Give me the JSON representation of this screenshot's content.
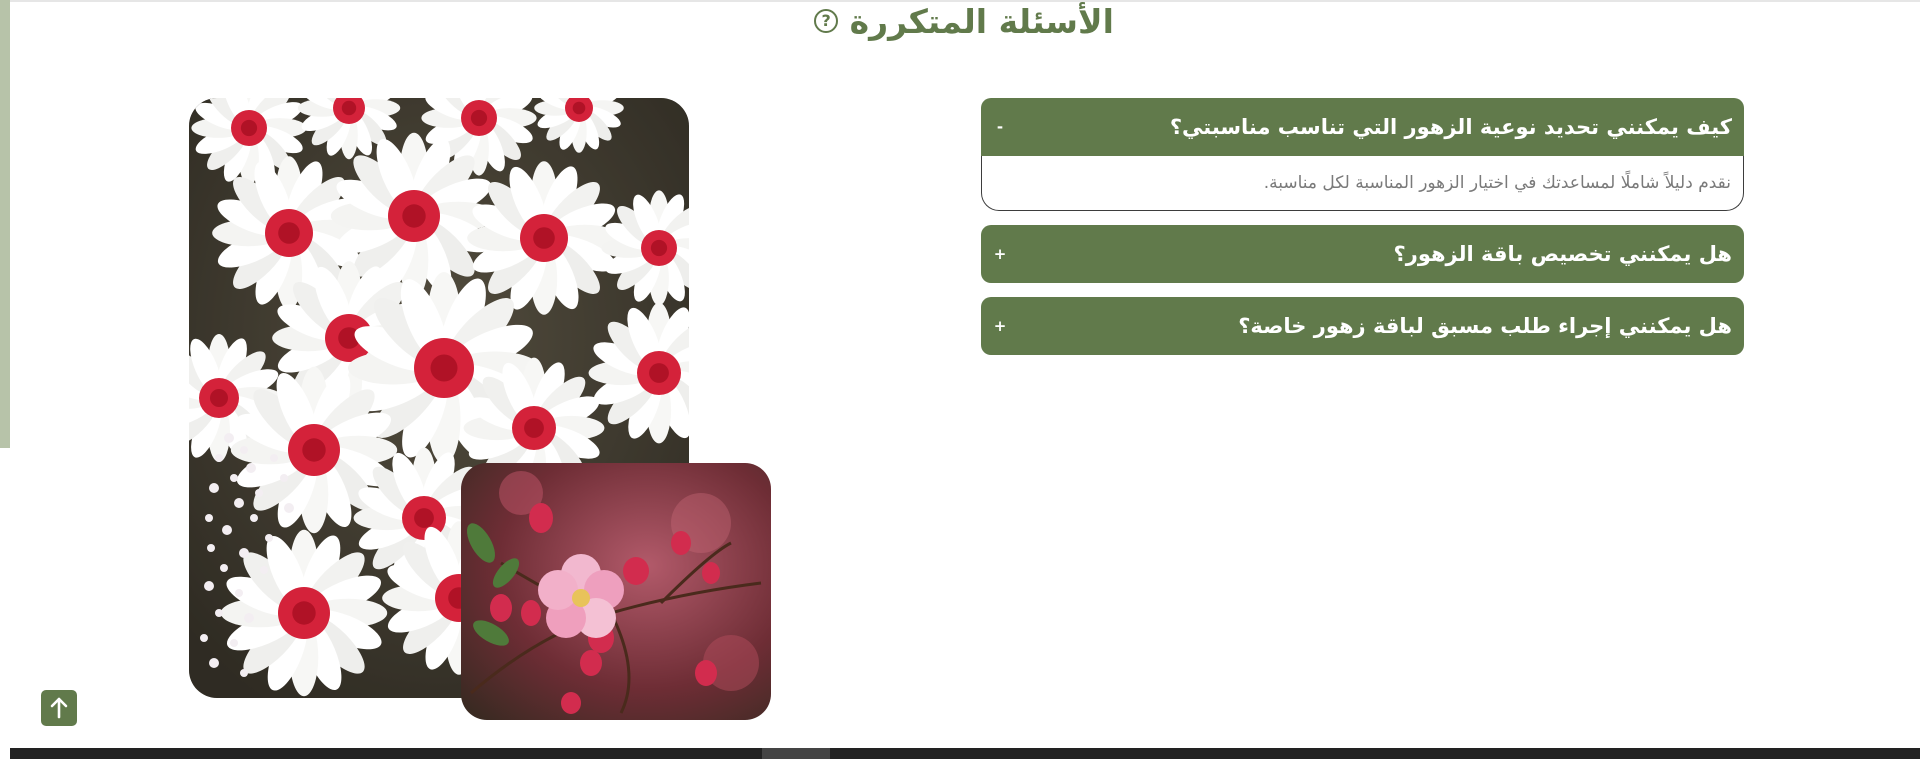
{
  "section": {
    "title": "الأسئلة المتكررة",
    "title_icon": "question-circle-icon",
    "accent_color": "#617a4b"
  },
  "images": {
    "main": "white-daisies-photo",
    "secondary": "pink-blossoms-photo"
  },
  "faq": [
    {
      "question": "كيف يمكنني تحديد نوعية الزهور التي تناسب مناسبتي؟",
      "toggle": "-",
      "expanded": true,
      "answer": "نقدم دليلاً شاملًا لمساعدتك في اختيار الزهور المناسبة لكل مناسبة."
    },
    {
      "question": "هل يمكنني تخصيص باقة الزهور؟",
      "toggle": "+",
      "expanded": false
    },
    {
      "question": "هل يمكنني إجراء طلب مسبق لباقة زهور خاصة؟",
      "toggle": "+",
      "expanded": false
    }
  ],
  "scroll_top_button": {
    "icon": "arrow-up-icon"
  }
}
